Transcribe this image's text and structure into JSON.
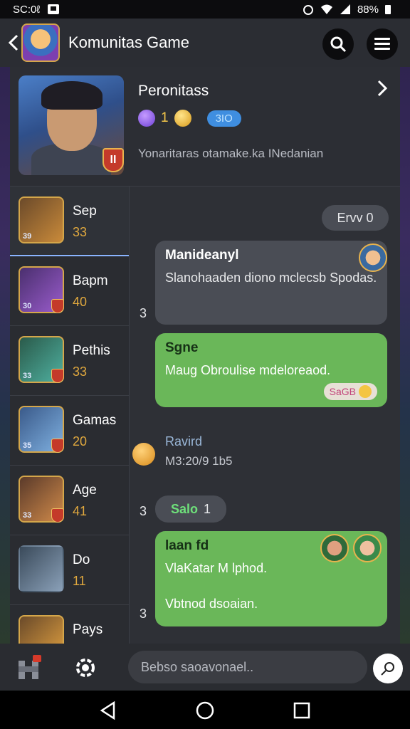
{
  "status": {
    "time": "SC:0ℓ",
    "battery": "88%"
  },
  "header": {
    "title": "Komunitas Game"
  },
  "profile": {
    "name": "Peronitass",
    "stat_value": "1",
    "level_badge": "3IO",
    "description": "Yonaritaras otamake.ka INedanian",
    "badge": "II"
  },
  "sidebar": {
    "items": [
      {
        "label": "Sep",
        "count": "33",
        "thumb_num": "39",
        "colors": [
          "#6b4a2a",
          "#c98a3a"
        ]
      },
      {
        "label": "Bapm",
        "count": "40",
        "thumb_num": "30",
        "colors": [
          "#4a2f6e",
          "#9a5ccc"
        ]
      },
      {
        "label": "Pethis",
        "count": "33",
        "thumb_num": "33",
        "colors": [
          "#2a5a4a",
          "#4fb0a0"
        ]
      },
      {
        "label": "Gamas",
        "count": "20",
        "thumb_num": "35",
        "colors": [
          "#3a5a8a",
          "#7fb0e0"
        ]
      },
      {
        "label": "Age",
        "count": "41",
        "thumb_num": "33",
        "colors": [
          "#5a3a2a",
          "#d08a4a"
        ]
      },
      {
        "label": "Do",
        "count": "11",
        "thumb_num": "",
        "colors": [
          "#3a4a5a",
          "#8aa0b8"
        ]
      },
      {
        "label": "Pays",
        "count": "",
        "thumb_num": "",
        "colors": [
          "#6a4a2a",
          "#e0a040"
        ]
      }
    ]
  },
  "chat": {
    "top_pill": "Ervv 0",
    "msg1": {
      "title": "Manideanyl",
      "text": "Slanohaaden diono mclecsb Spodas.",
      "side_num": "3"
    },
    "msg2": {
      "title": "Sgne",
      "text": "Maug Obroulise mdeloreaod.",
      "reaction": "SaGB"
    },
    "event": {
      "title": "Ravird",
      "time": "M3:20/9 1b5"
    },
    "sale_pill": {
      "label": "Salo",
      "count": "1",
      "side_num": "3"
    },
    "msg3": {
      "title": "laan fd",
      "line1": "VlaKatar M lphod.",
      "line2": "Vbtnod dsoaian.",
      "side_num": "3"
    }
  },
  "composer": {
    "placeholder": "Bebso saoavonael.."
  },
  "colors": {
    "green_bubble": "#6ab759",
    "gray_bubble": "#4a4d55",
    "accent_gold": "#e0a83e"
  },
  "icons": [
    "back-icon",
    "search-icon",
    "menu-icon",
    "chevron-right-icon",
    "gem-icon",
    "coin-icon",
    "settings-icon",
    "castle-icon",
    "send-icon"
  ]
}
